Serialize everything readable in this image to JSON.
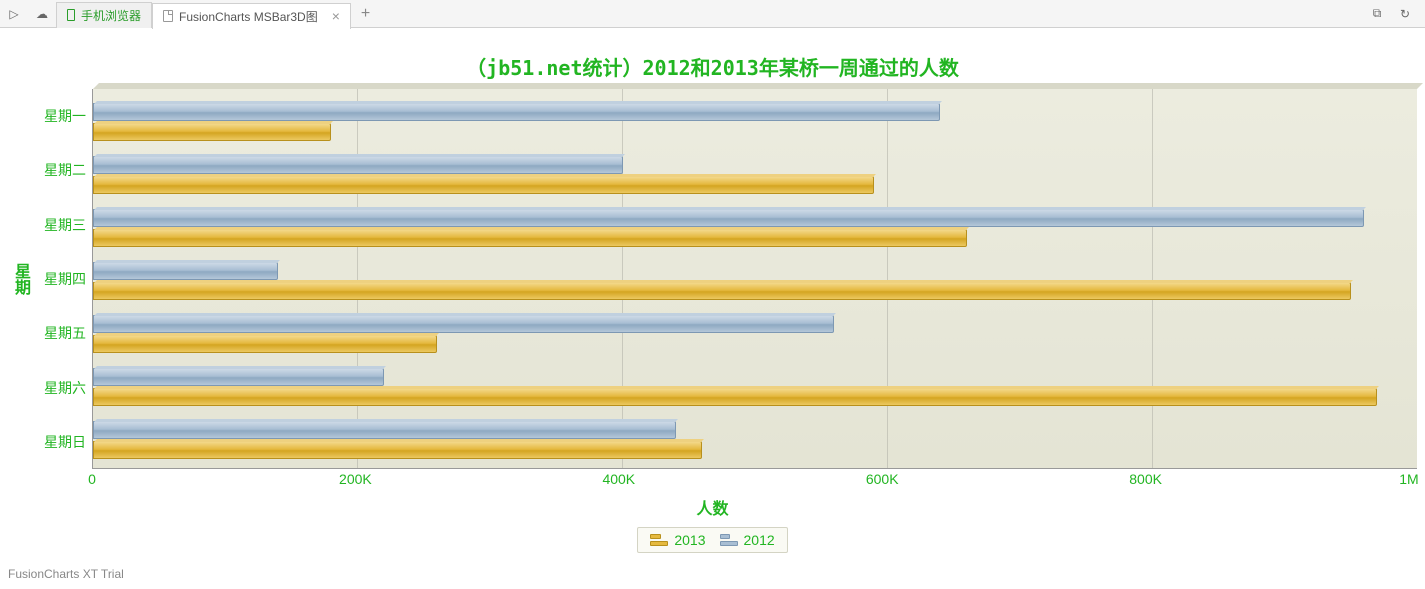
{
  "tabs": {
    "mobile_label": "手机浏览器",
    "active_label": "FusionCharts MSBar3D图"
  },
  "chart_data": {
    "type": "bar",
    "title": "（jb51.net统计）2012和2013年某桥一周通过的人数",
    "xlabel": "人数",
    "ylabel": "星期",
    "xlim": [
      0,
      1000000
    ],
    "x_ticks": [
      "0",
      "200K",
      "400K",
      "600K",
      "800K",
      "1M"
    ],
    "categories": [
      "星期一",
      "星期二",
      "星期三",
      "星期四",
      "星期五",
      "星期六",
      "星期日"
    ],
    "series": [
      {
        "name": "2012",
        "color": "blue",
        "values": [
          640000,
          400000,
          960000,
          140000,
          560000,
          220000,
          440000
        ]
      },
      {
        "name": "2013",
        "color": "gold",
        "values": [
          180000,
          590000,
          660000,
          950000,
          260000,
          970000,
          460000
        ]
      }
    ],
    "legend_order": [
      "2013",
      "2012"
    ]
  },
  "watermark": "FusionCharts XT Trial"
}
